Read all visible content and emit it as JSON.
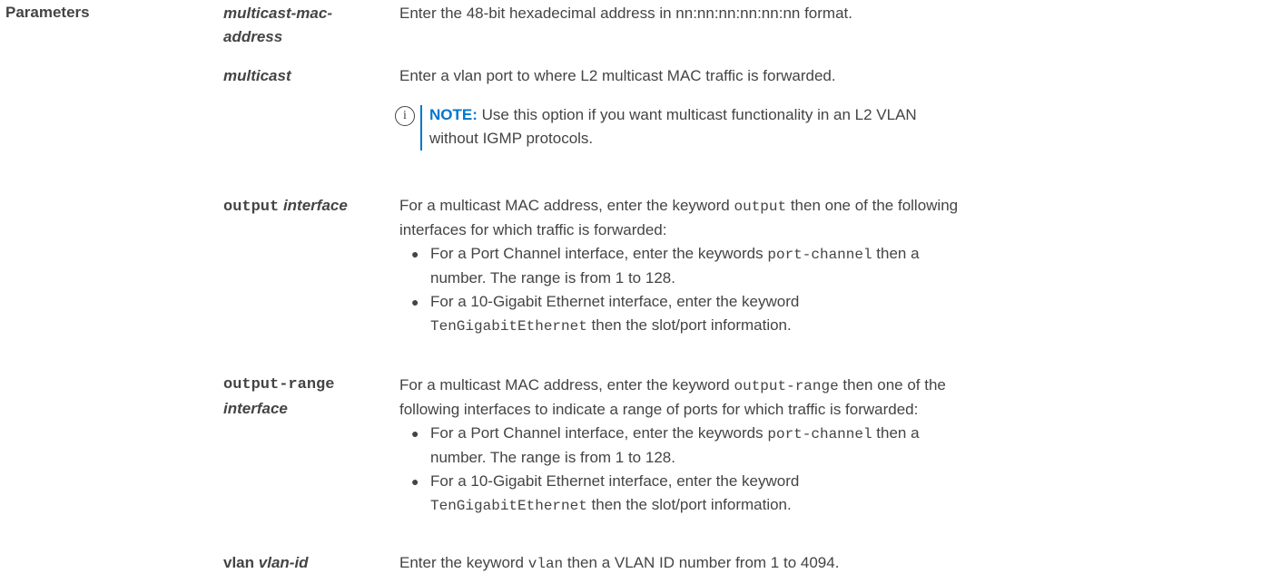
{
  "section": {
    "label": "Parameters"
  },
  "params": {
    "mac_addr": {
      "term_line1": "multicast-mac-",
      "term_line2": "address",
      "desc": "Enter the 48-bit hexadecimal address in nn:nn:nn:nn:nn:nn format."
    },
    "multicast": {
      "term": "multicast",
      "desc": "Enter a vlan port to where L2 multicast MAC traffic is forwarded.",
      "note_label": "NOTE:",
      "note_text_line1": " Use this option if you want multicast functionality in an L2 VLAN",
      "note_text_line2": "without IGMP protocols."
    },
    "output": {
      "term_kw": "output",
      "term_var": "interface",
      "desc_pre": "For a multicast MAC address, enter the keyword ",
      "desc_kw": "output",
      "desc_post": " then one of the following",
      "desc_line2": "interfaces for which traffic is forwarded:",
      "b1_pre": "For a Port Channel interface, enter the keywords ",
      "b1_kw": "port-channel",
      "b1_post": " then a",
      "b1_line2": "number. The range is from 1 to 128.",
      "b2_line1": "For a 10-Gigabit Ethernet interface, enter the keyword",
      "b2_kw": "TenGigabitEthernet",
      "b2_post": " then the slot/port information."
    },
    "output_range": {
      "term_kw": "output-range",
      "term_var": "interface",
      "desc_pre": "For a multicast MAC address, enter the keyword ",
      "desc_kw": "output-range",
      "desc_post": " then one of the",
      "desc_line2": "following interfaces to indicate a range of ports for which traffic is forwarded:",
      "b1_pre": "For a Port Channel interface, enter the keywords ",
      "b1_kw": "port-channel",
      "b1_post": " then a",
      "b1_line2": "number. The range is from 1 to 128.",
      "b2_line1": "For a 10-Gigabit Ethernet interface, enter the keyword",
      "b2_kw": "TenGigabitEthernet",
      "b2_post": " then the slot/port information."
    },
    "vlan": {
      "term_kw": "vlan",
      "term_var": "vlan-id",
      "desc_pre": "Enter the keyword ",
      "desc_kw": "vlan",
      "desc_post": " then a VLAN ID number from 1 to 4094."
    }
  },
  "colors": {
    "text": "#444444",
    "accent": "#0076ce"
  },
  "icons": {
    "note": "info-icon"
  }
}
